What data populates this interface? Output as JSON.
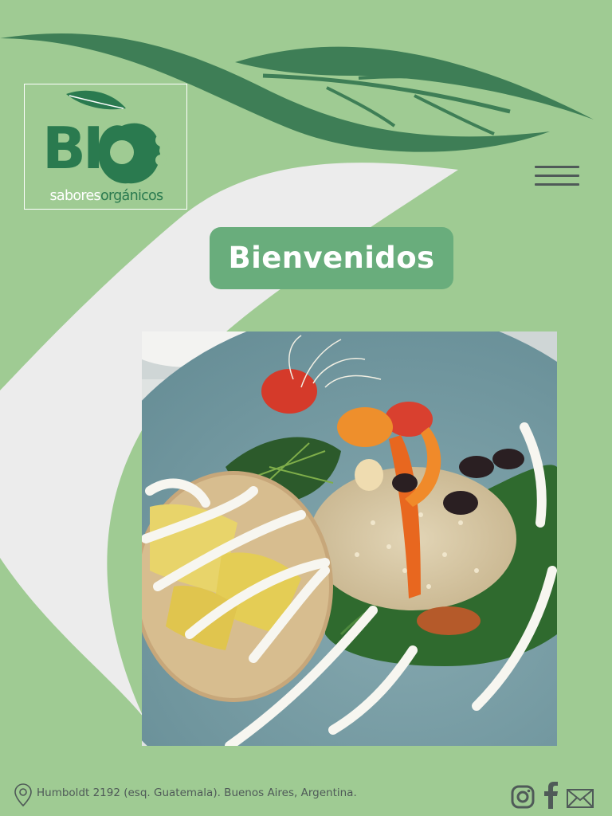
{
  "brand": {
    "logo_main": "BI",
    "tagline_part1": "sabores",
    "tagline_part2": "orgánicos"
  },
  "header": {
    "menu_icon": "hamburger-menu-icon"
  },
  "hero": {
    "welcome_label": "Bienvenidos",
    "photo_subject": "plated dish with veggie patty, quinoa, greens and roasted vegetables"
  },
  "footer": {
    "address": "Humboldt 2192 (esq. Guatemala). Buenos Aires, Argentina.",
    "address_icon": "map-pin-icon",
    "social": [
      {
        "name": "instagram",
        "icon": "instagram-icon"
      },
      {
        "name": "facebook",
        "icon": "facebook-icon"
      },
      {
        "name": "email",
        "icon": "envelope-icon"
      }
    ]
  },
  "colors": {
    "background": "#9fcb93",
    "brand_green": "#2a7a4f",
    "leaf_green": "#3e7e56",
    "welcome_button": "#69ad7c",
    "light_shape": "#ececec",
    "icon_gray": "#4f5a58"
  }
}
